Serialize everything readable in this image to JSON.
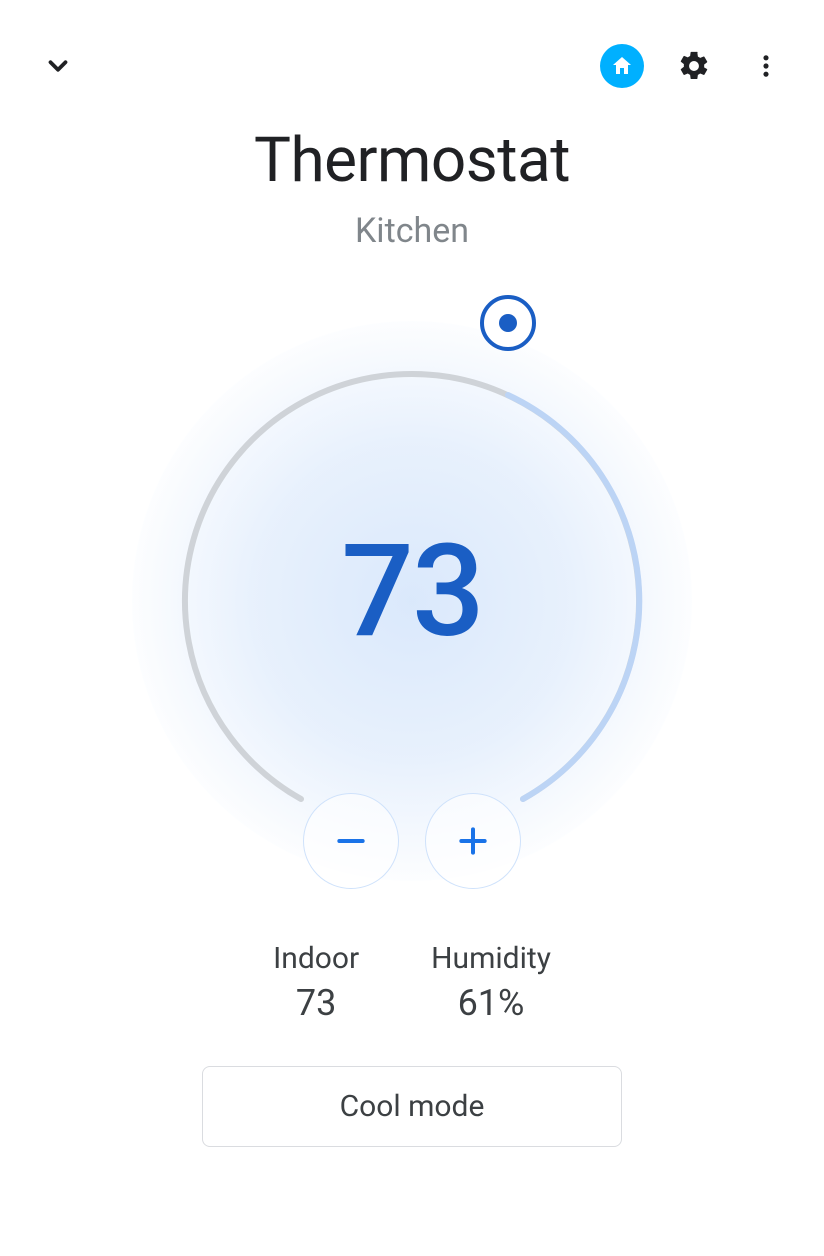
{
  "header": {
    "title": "Thermostat",
    "subtitle": "Kitchen"
  },
  "dial": {
    "set_temp": "73",
    "arc_progress_deg": 25,
    "colors": {
      "track": "#cfd3d8",
      "progress": "#bcd4f5",
      "handle": "#1a5ec4",
      "temp_text": "#1a5ec4"
    }
  },
  "stats": {
    "indoor": {
      "label": "Indoor",
      "value": "73"
    },
    "humidity": {
      "label": "Humidity",
      "value": "61%"
    }
  },
  "mode_button": {
    "label": "Cool mode"
  },
  "icons": {
    "home_accent": "#00b0ff"
  }
}
